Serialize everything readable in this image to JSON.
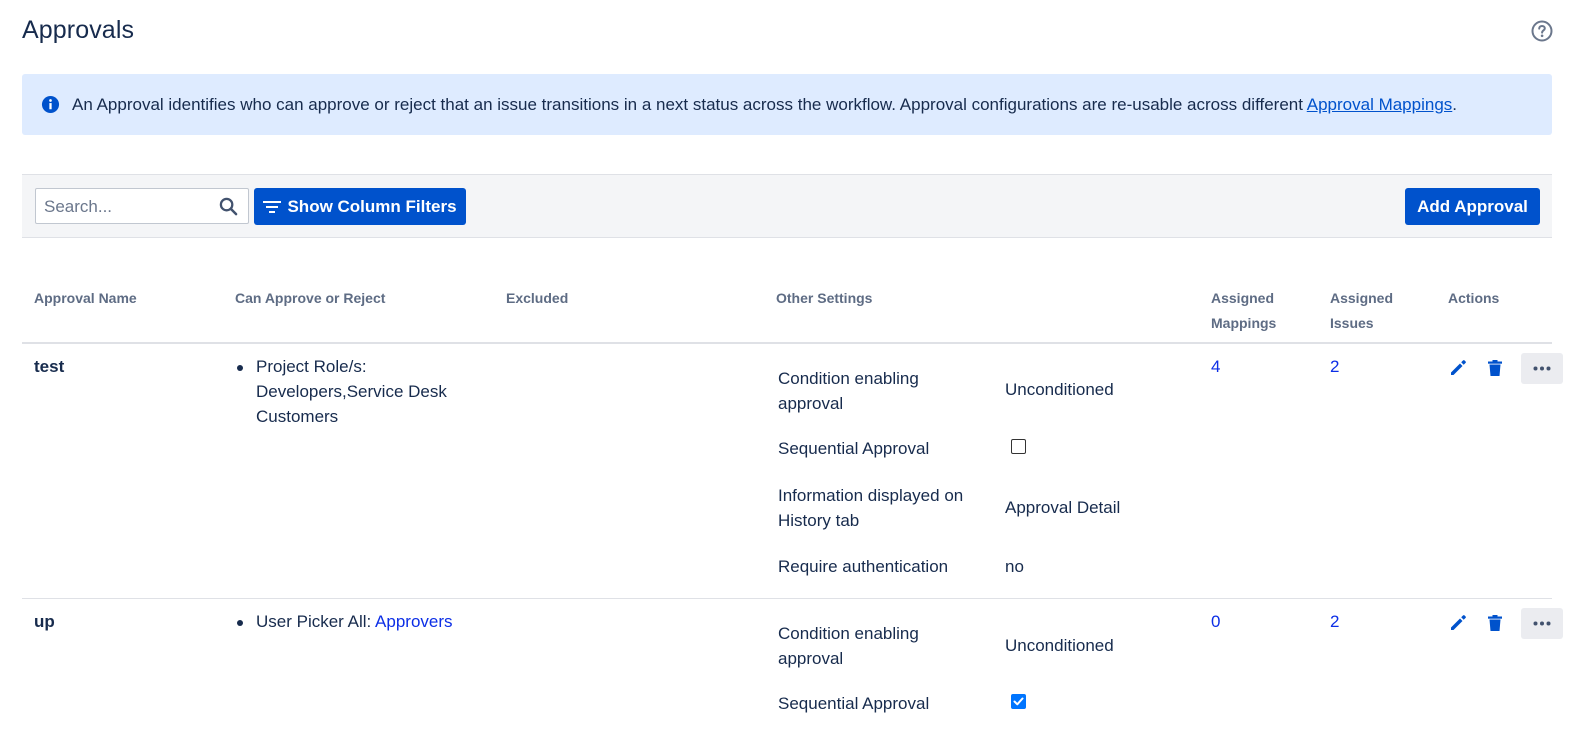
{
  "page": {
    "title": "Approvals",
    "help_icon": "question-circle-icon"
  },
  "banner": {
    "text": "An Approval identifies who can approve or reject that an issue transitions in a next status across the workflow. Approval configurations are re-usable across different ",
    "link": "Approval Mappings",
    "suffix": "."
  },
  "toolbar": {
    "search_placeholder": "Search...",
    "filters_label": "Show Column Filters",
    "add_label": "Add Approval"
  },
  "columns": {
    "name": "Approval Name",
    "can_approve": "Can Approve or Reject",
    "excluded": "Excluded",
    "other": "Other Settings",
    "mappings_line1": "Assigned",
    "mappings_line2": "Mappings",
    "issues_line1": "Assigned",
    "issues_line2": "Issues",
    "actions": "Actions"
  },
  "rows": [
    {
      "name": "test",
      "approvers_line1": "Project Role/s:",
      "approvers_line2": "Developers,Service Desk",
      "approvers_line3": "Customers",
      "settings": {
        "condition_label_1": "Condition enabling",
        "condition_label_2": "approval",
        "condition_value": "Unconditioned",
        "sequential_label": "Sequential Approval",
        "sequential_checked": false,
        "info_label_1": "Information displayed on",
        "info_label_2": "History tab",
        "info_value": "Approval Detail",
        "auth_label": "Require authentication",
        "auth_value": "no"
      },
      "mappings": "4",
      "issues": "2"
    },
    {
      "name": "up",
      "approvers_prefix": "User Picker All: ",
      "approvers_link": "Approvers",
      "settings": {
        "condition_label_1": "Condition enabling",
        "condition_label_2": "approval",
        "condition_value": "Unconditioned",
        "sequential_label": "Sequential Approval",
        "sequential_checked": true
      },
      "mappings": "0",
      "issues": "2"
    }
  ],
  "colors": {
    "primary": "#0052cc",
    "banner_bg": "#deebff",
    "link": "#0c2ee6"
  }
}
